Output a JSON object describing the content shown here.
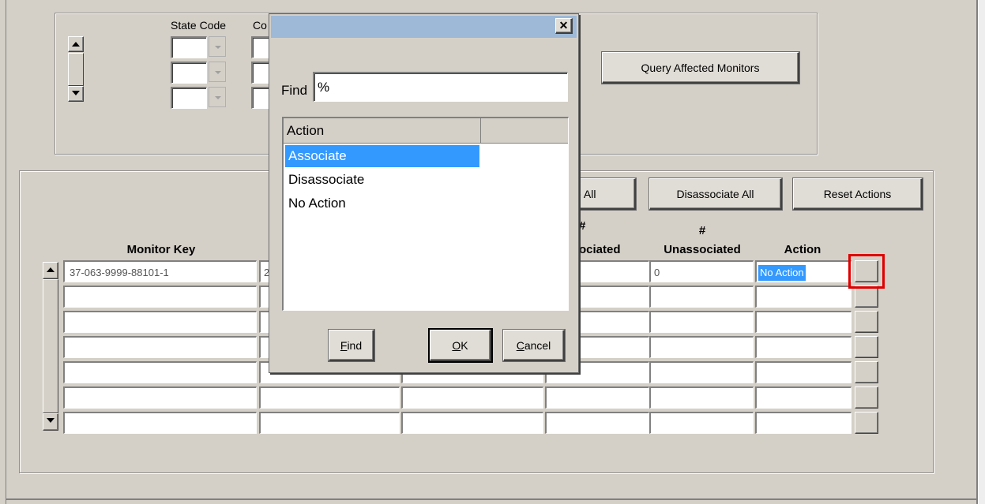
{
  "top_form": {
    "state_code_label": "State Code",
    "county_label_fragment": "Co",
    "query_button_label": "Query Affected Monitors"
  },
  "action_bar": {
    "associate_all_fragment": "e All",
    "disassociate_all_label": "Disassociate All",
    "reset_actions_label": "Reset Actions"
  },
  "grid": {
    "headers": {
      "monitor_key": "Monitor Key",
      "associated_hash": "#",
      "associated_fragment": "ociated",
      "unassociated_hash": "#",
      "unassociated": "Unassociated",
      "action": "Action"
    },
    "row1": {
      "monitor_key": "37-063-9999-88101-1",
      "col2_fragment": "2",
      "unassociated": "0",
      "action": "No Action"
    }
  },
  "dialog": {
    "close_glyph": "✕",
    "find_label": "Find",
    "find_value": "%",
    "list_header": "Action",
    "items": [
      "Associate",
      "Disassociate",
      "No Action"
    ],
    "find_button_rest": "ind",
    "find_button_mnemonic": "F",
    "ok_button_mnemonic": "O",
    "ok_button_rest": "K",
    "cancel_button_mnemonic": "C",
    "cancel_button_rest": "ancel"
  },
  "colors": {
    "window_bg": "#d4d0c8",
    "title_bar": "#9db9d7",
    "selection": "#3399ff",
    "highlight_box": "#e00000"
  }
}
